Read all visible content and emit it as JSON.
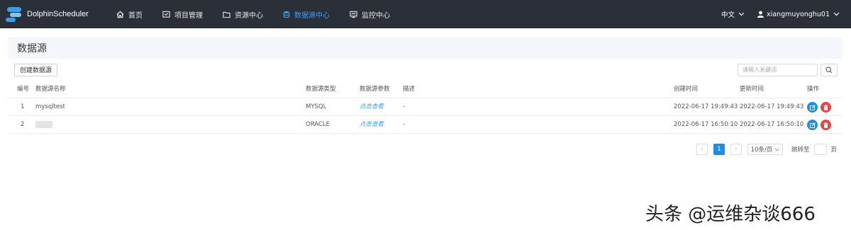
{
  "app": {
    "name": "DolphinScheduler"
  },
  "nav": {
    "items": [
      {
        "label": "首页",
        "icon": "home-icon"
      },
      {
        "label": "项目管理",
        "icon": "project-icon"
      },
      {
        "label": "资源中心",
        "icon": "folder-icon"
      },
      {
        "label": "数据源中心",
        "icon": "database-icon",
        "active": true
      },
      {
        "label": "监控中心",
        "icon": "monitor-icon"
      }
    ],
    "language": "中文",
    "user": "xiangmuyonghu01"
  },
  "page": {
    "title": "数据源",
    "create_label": "创建数据源",
    "search_placeholder": "请输入关键词"
  },
  "table": {
    "headers": {
      "no": "编号",
      "name": "数据源名称",
      "type": "数据源类型",
      "params": "数据源参数",
      "desc": "描述",
      "created": "创建时间",
      "updated": "更新时间",
      "ops": "操作"
    },
    "rows": [
      {
        "no": "1",
        "name": "mysqltest",
        "type": "MYSQL",
        "params": "点击查看",
        "desc": "-",
        "created": "2022-06-17 19:49:43",
        "updated": "2022-06-17 19:49:43"
      },
      {
        "no": "2",
        "name": "",
        "type": "ORACLE",
        "params": "点击查看",
        "desc": "-",
        "created": "2022-06-17 16:50:10",
        "updated": "2022-06-17 16:50:10"
      }
    ]
  },
  "pagination": {
    "prev": "‹",
    "current": "1",
    "next": "›",
    "page_size": "10条/页",
    "jump_label": "跳转至",
    "page_unit": "页"
  },
  "watermark": "头条 @运维杂谈666",
  "colors": {
    "accent": "#1f8ce6",
    "danger": "#ee4141",
    "topbar": "#2b2f38"
  }
}
